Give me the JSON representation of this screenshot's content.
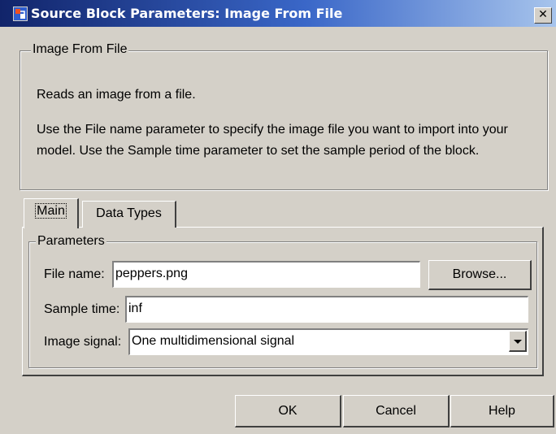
{
  "window": {
    "title": "Source Block Parameters: Image From File",
    "close_glyph": "✕",
    "icon": "simulink-block-icon"
  },
  "description": {
    "group_title": "Image From File",
    "line1": "Reads an image from a file.",
    "line2": "Use the File name parameter to specify the image file you want to import into your",
    "line3": "model. Use the Sample time parameter to set the sample period of the block."
  },
  "tabs": [
    {
      "label": "Main",
      "selected": true
    },
    {
      "label": "Data Types",
      "selected": false
    }
  ],
  "parameters": {
    "group_title": "Parameters",
    "file_name": {
      "label": "File name:",
      "value": "peppers.png",
      "browse_label": "Browse..."
    },
    "sample_time": {
      "label": "Sample time:",
      "value": "inf"
    },
    "image_signal": {
      "label": "Image signal:",
      "value": "One multidimensional signal"
    }
  },
  "buttons": {
    "ok": "OK",
    "cancel": "Cancel",
    "help": "Help"
  }
}
